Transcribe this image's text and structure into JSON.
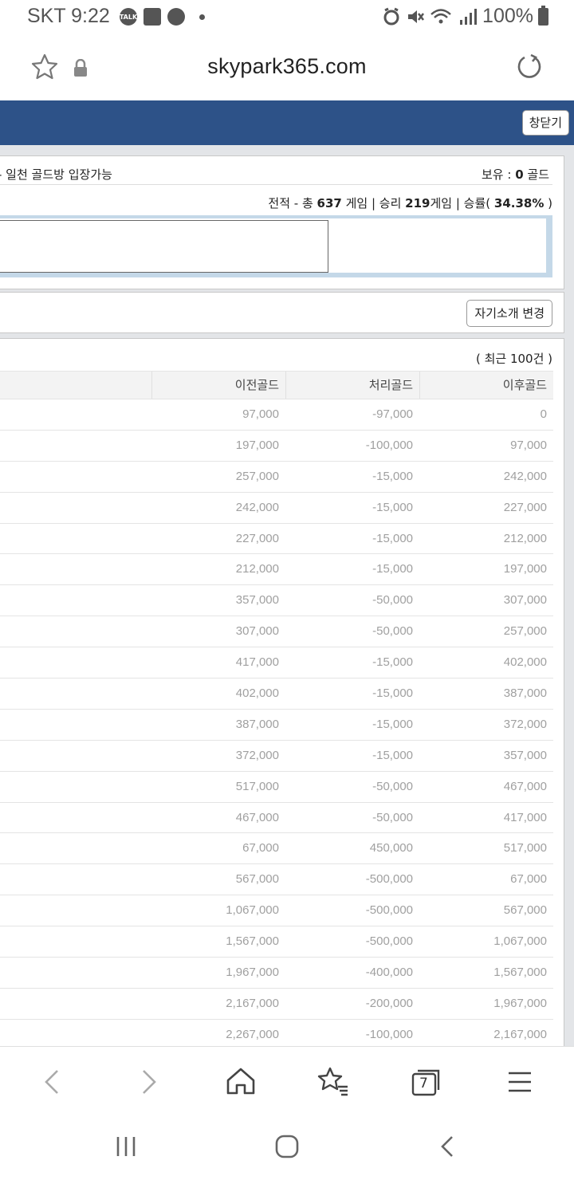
{
  "status_bar": {
    "carrier_time": "SKT 9:22",
    "talk_badge": "TALK",
    "battery_pct": "100%",
    "icons": [
      "talk-icon",
      "note-icon",
      "media-icon",
      "alarm-icon",
      "mute-icon",
      "wifi-icon",
      "signal-icon",
      "battery-icon"
    ]
  },
  "url_bar": {
    "url": "skypark365.com",
    "icons": [
      "star-icon",
      "lock-icon",
      "reload-icon"
    ]
  },
  "header": {
    "close_label": "창닫기",
    "color": "#2d5288"
  },
  "profile": {
    "entry_note": "- 일천 골드방 입장가능",
    "holdings_prefix": "보유 : ",
    "holdings_value": "0",
    "holdings_suffix": " 골드",
    "record_prefix": "전적 - 총 ",
    "record_total": "637",
    "record_mid1": " 게임 | 승리 ",
    "record_wins": "219",
    "record_mid2": "게임 | 승률( ",
    "record_rate": "34.38%",
    "record_end": " )",
    "intro_input_value": ""
  },
  "intro": {
    "change_button": "자기소개 변경"
  },
  "history": {
    "recent_label": "( 최근 100건 )",
    "columns": [
      "",
      "이전골드",
      "처리골드",
      "이후골드"
    ],
    "rows": [
      [
        "97,000",
        "-97,000",
        "0"
      ],
      [
        "197,000",
        "-100,000",
        "97,000"
      ],
      [
        "257,000",
        "-15,000",
        "242,000"
      ],
      [
        "242,000",
        "-15,000",
        "227,000"
      ],
      [
        "227,000",
        "-15,000",
        "212,000"
      ],
      [
        "212,000",
        "-15,000",
        "197,000"
      ],
      [
        "357,000",
        "-50,000",
        "307,000"
      ],
      [
        "307,000",
        "-50,000",
        "257,000"
      ],
      [
        "417,000",
        "-15,000",
        "402,000"
      ],
      [
        "402,000",
        "-15,000",
        "387,000"
      ],
      [
        "387,000",
        "-15,000",
        "372,000"
      ],
      [
        "372,000",
        "-15,000",
        "357,000"
      ],
      [
        "517,000",
        "-50,000",
        "467,000"
      ],
      [
        "467,000",
        "-50,000",
        "417,000"
      ],
      [
        "67,000",
        "450,000",
        "517,000"
      ],
      [
        "567,000",
        "-500,000",
        "67,000"
      ],
      [
        "1,067,000",
        "-500,000",
        "567,000"
      ],
      [
        "1,567,000",
        "-500,000",
        "1,067,000"
      ],
      [
        "1,967,000",
        "-400,000",
        "1,567,000"
      ],
      [
        "2,167,000",
        "-200,000",
        "1,967,000"
      ],
      [
        "2,267,000",
        "-100,000",
        "2,167,000"
      ]
    ]
  },
  "browser_nav": {
    "tab_count": "7",
    "icons": [
      "back-icon",
      "forward-icon",
      "home-icon",
      "bookmarks-icon",
      "tabs-icon",
      "menu-icon"
    ]
  },
  "system_nav": {
    "icons": [
      "recent-apps-icon",
      "home-button-icon",
      "back-button-icon"
    ]
  }
}
